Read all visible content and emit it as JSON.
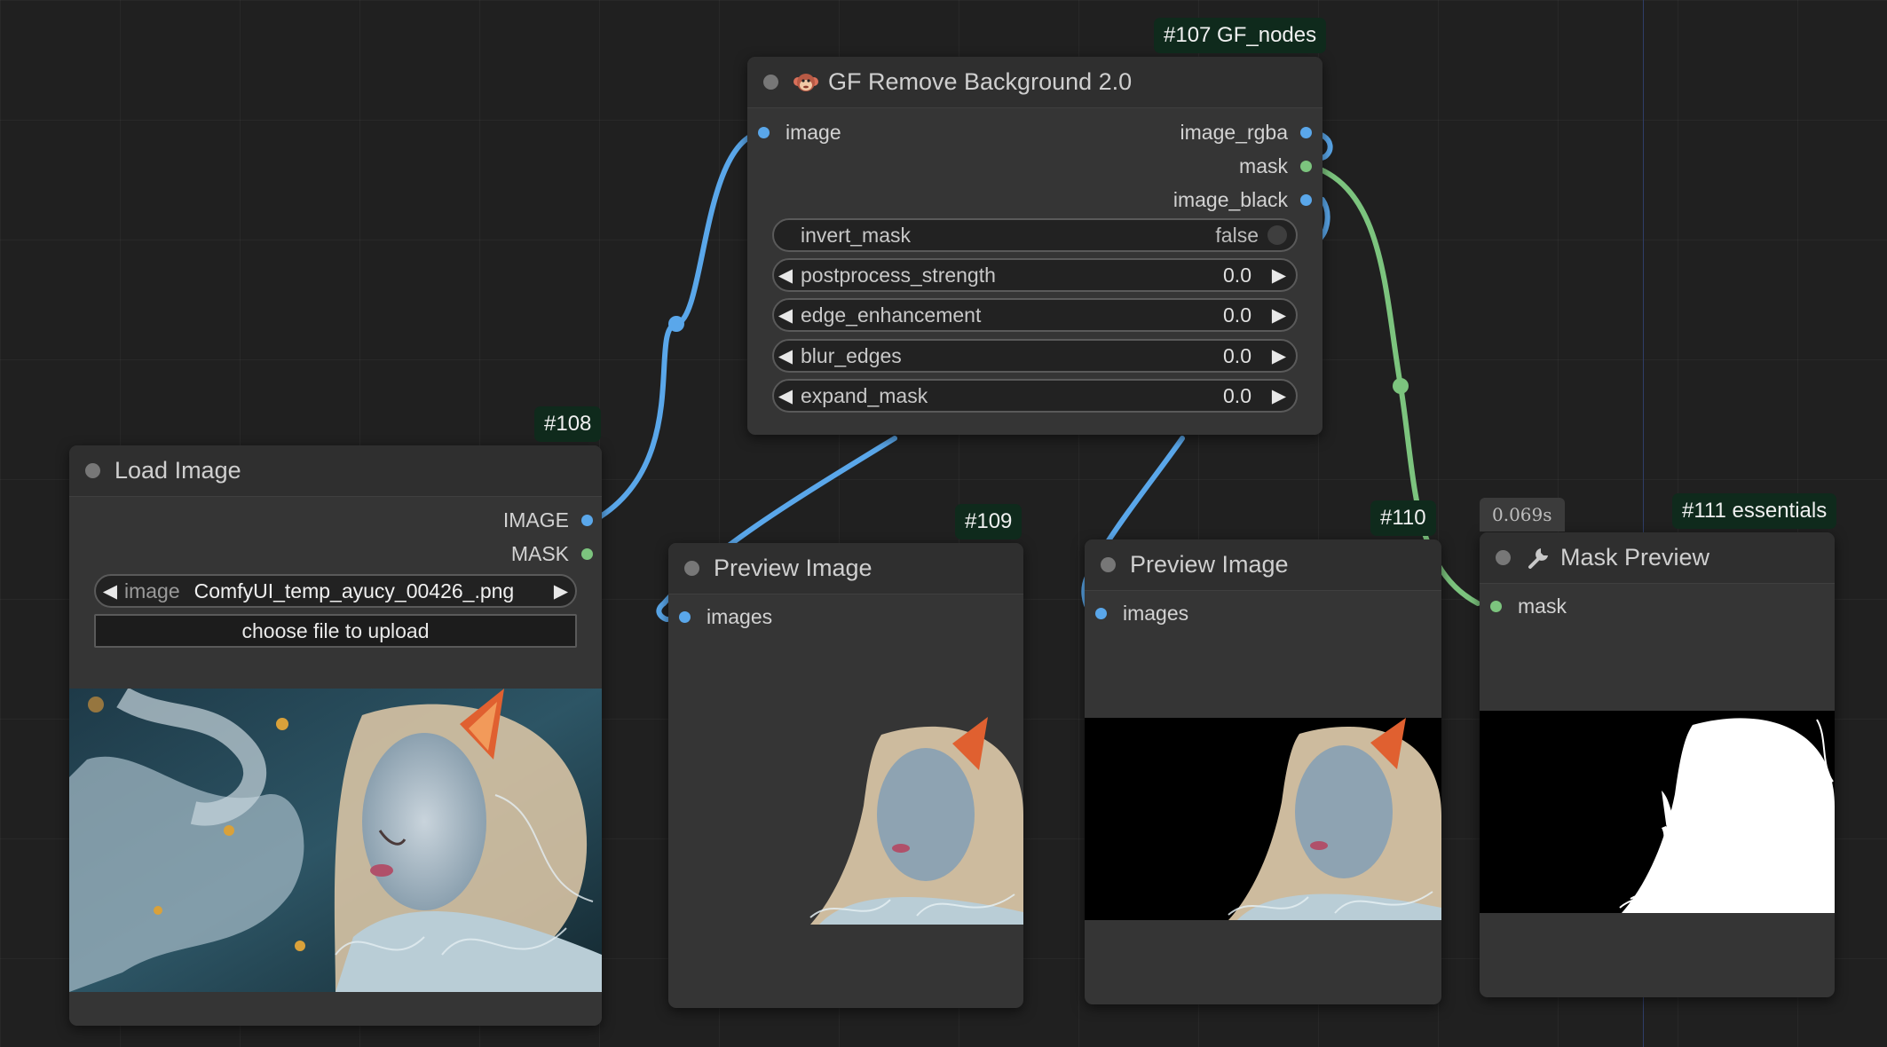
{
  "nodes": {
    "gf_remove_bg": {
      "badge": "#107 GF_nodes",
      "title": "GF Remove Background 2.0",
      "input": "image",
      "outputs": [
        "image_rgba",
        "mask",
        "image_black"
      ],
      "invert_mask": {
        "label": "invert_mask",
        "value": "false"
      },
      "widgets": [
        {
          "label": "postprocess_strength",
          "value": "0.0"
        },
        {
          "label": "edge_enhancement",
          "value": "0.0"
        },
        {
          "label": "blur_edges",
          "value": "0.0"
        },
        {
          "label": "expand_mask",
          "value": "0.0"
        }
      ]
    },
    "load_image": {
      "badge": "#108",
      "title": "Load Image",
      "outputs": [
        "IMAGE",
        "MASK"
      ],
      "image_label": "image",
      "image_value": "ComfyUI_temp_ayucy_00426_.png",
      "upload_label": "choose file to upload"
    },
    "preview_109": {
      "badge": "#109",
      "title": "Preview Image",
      "input": "images"
    },
    "preview_110": {
      "badge": "#110",
      "title": "Preview Image",
      "input": "images"
    },
    "mask_preview": {
      "badge": "#111 essentials",
      "timing": "0.069s",
      "title": "Mask Preview",
      "input": "mask"
    }
  },
  "colors": {
    "image_link": "#5aa7ea",
    "mask_link": "#7cc47e",
    "badge_bg": "#0f2a1c"
  },
  "icons": [
    "monkey-icon",
    "wrench-icon",
    "left-arrow-icon",
    "right-arrow-icon",
    "toggle-icon"
  ]
}
